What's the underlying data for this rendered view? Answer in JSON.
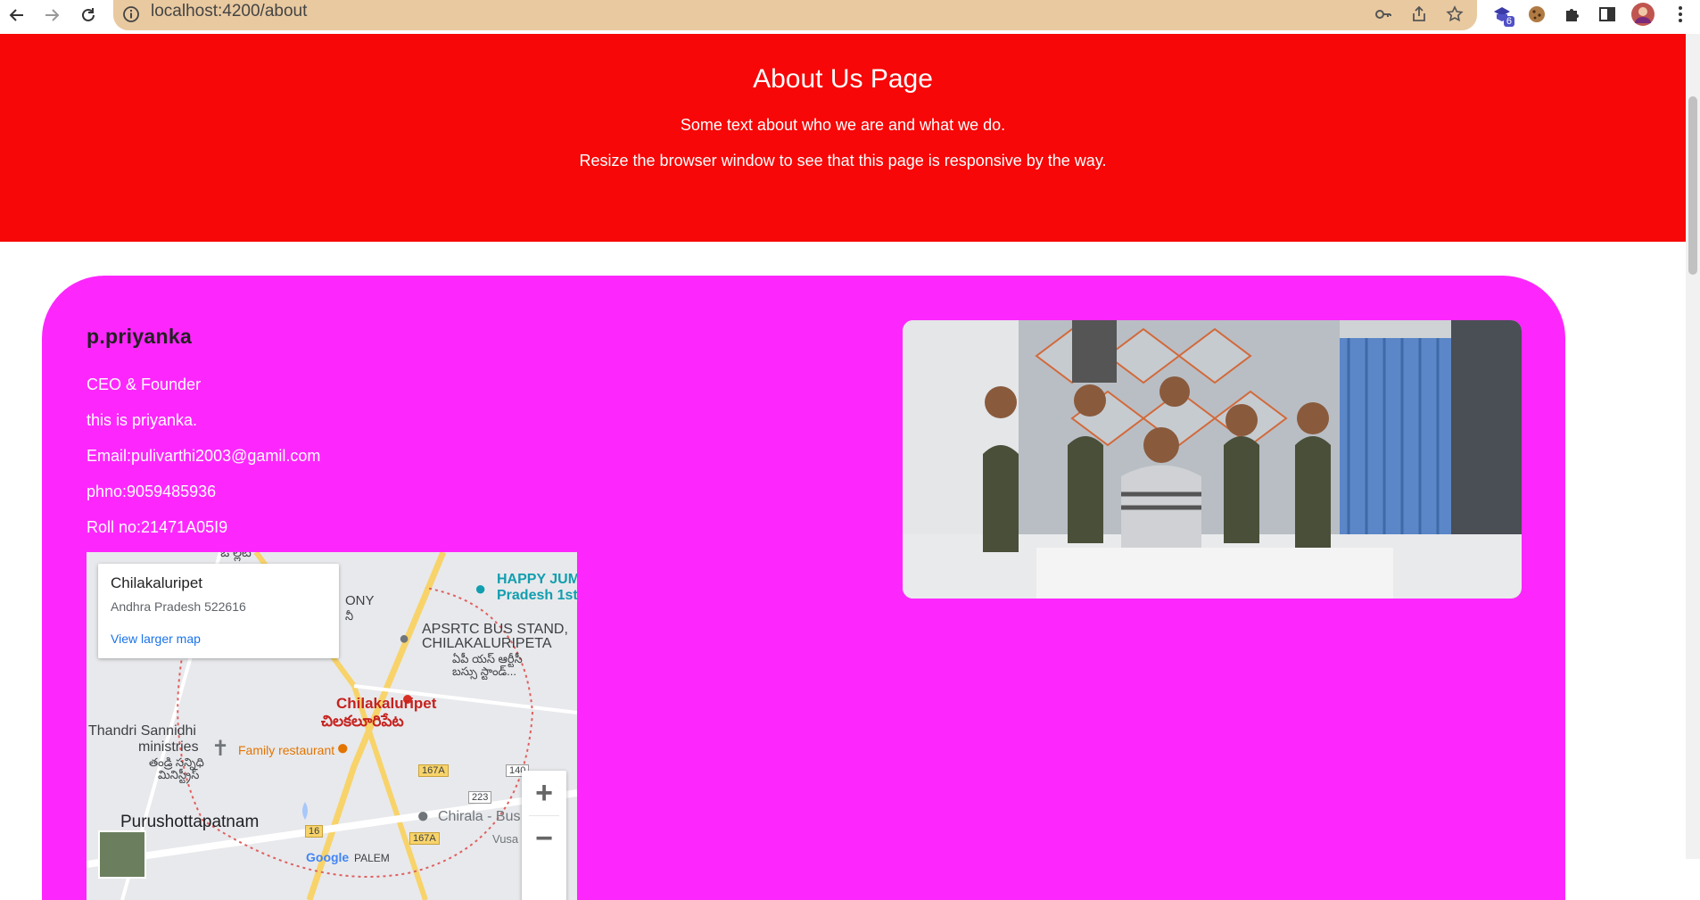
{
  "browser": {
    "url": "localhost:4200/about",
    "extension_badge": "6"
  },
  "hero": {
    "title": "About Us Page",
    "line1": "Some text about who we are and what we do.",
    "line2": "Resize the browser window to see that this page is responsive by the way."
  },
  "profile": {
    "name": "p.priyanka",
    "role": "CEO & Founder",
    "bio": "this is priyanka.",
    "email": "Email:pulivarthi2003@gamil.com",
    "phone": "phno:9059485936",
    "roll": "Roll no:21471A05I9"
  },
  "map": {
    "place_title": "Chilakaluripet",
    "place_address": "Andhra Pradesh 522616",
    "view_larger": "View larger map",
    "zoom_in": "+",
    "zoom_out": "−",
    "labels": {
      "city": "Chilakaluripet",
      "city_te": "చిలకలూరిపేట",
      "bus_stand": "APSRTC BUS STAND,",
      "bus_stand2": "CHILAKALURIPETA",
      "bus_te": "ఏపీ యస్ ఆర్టీసీ",
      "bus_te2": "బస్సు స్టాండ్...",
      "happy": "HAPPY JUM",
      "happy2": "Pradesh 1st",
      "thandri": "Thandri Sannidhi",
      "ministries": "ministries",
      "thandri_te": "తండ్రి సన్నిధి",
      "thandri_te2": "మినిస్ట్రీస్",
      "restaurant": "Family restaurant",
      "purushottapatnam": "Purushottapatnam",
      "chirala": "Chirala - Bus",
      "vusa": "Vusa",
      "road_167a": "167A",
      "road_167a_2": "167A",
      "road_16": "16",
      "road_223": "223",
      "road_140": "140",
      "colony": "ONY",
      "colony_te": "నీ",
      "top_te": "ఒ ల్లెట్",
      "palem": "PALEM"
    }
  },
  "colors": {
    "hero_bg": "#f70707",
    "card_bg": "#fd27fd",
    "address_bar": "#e9c9a0"
  }
}
